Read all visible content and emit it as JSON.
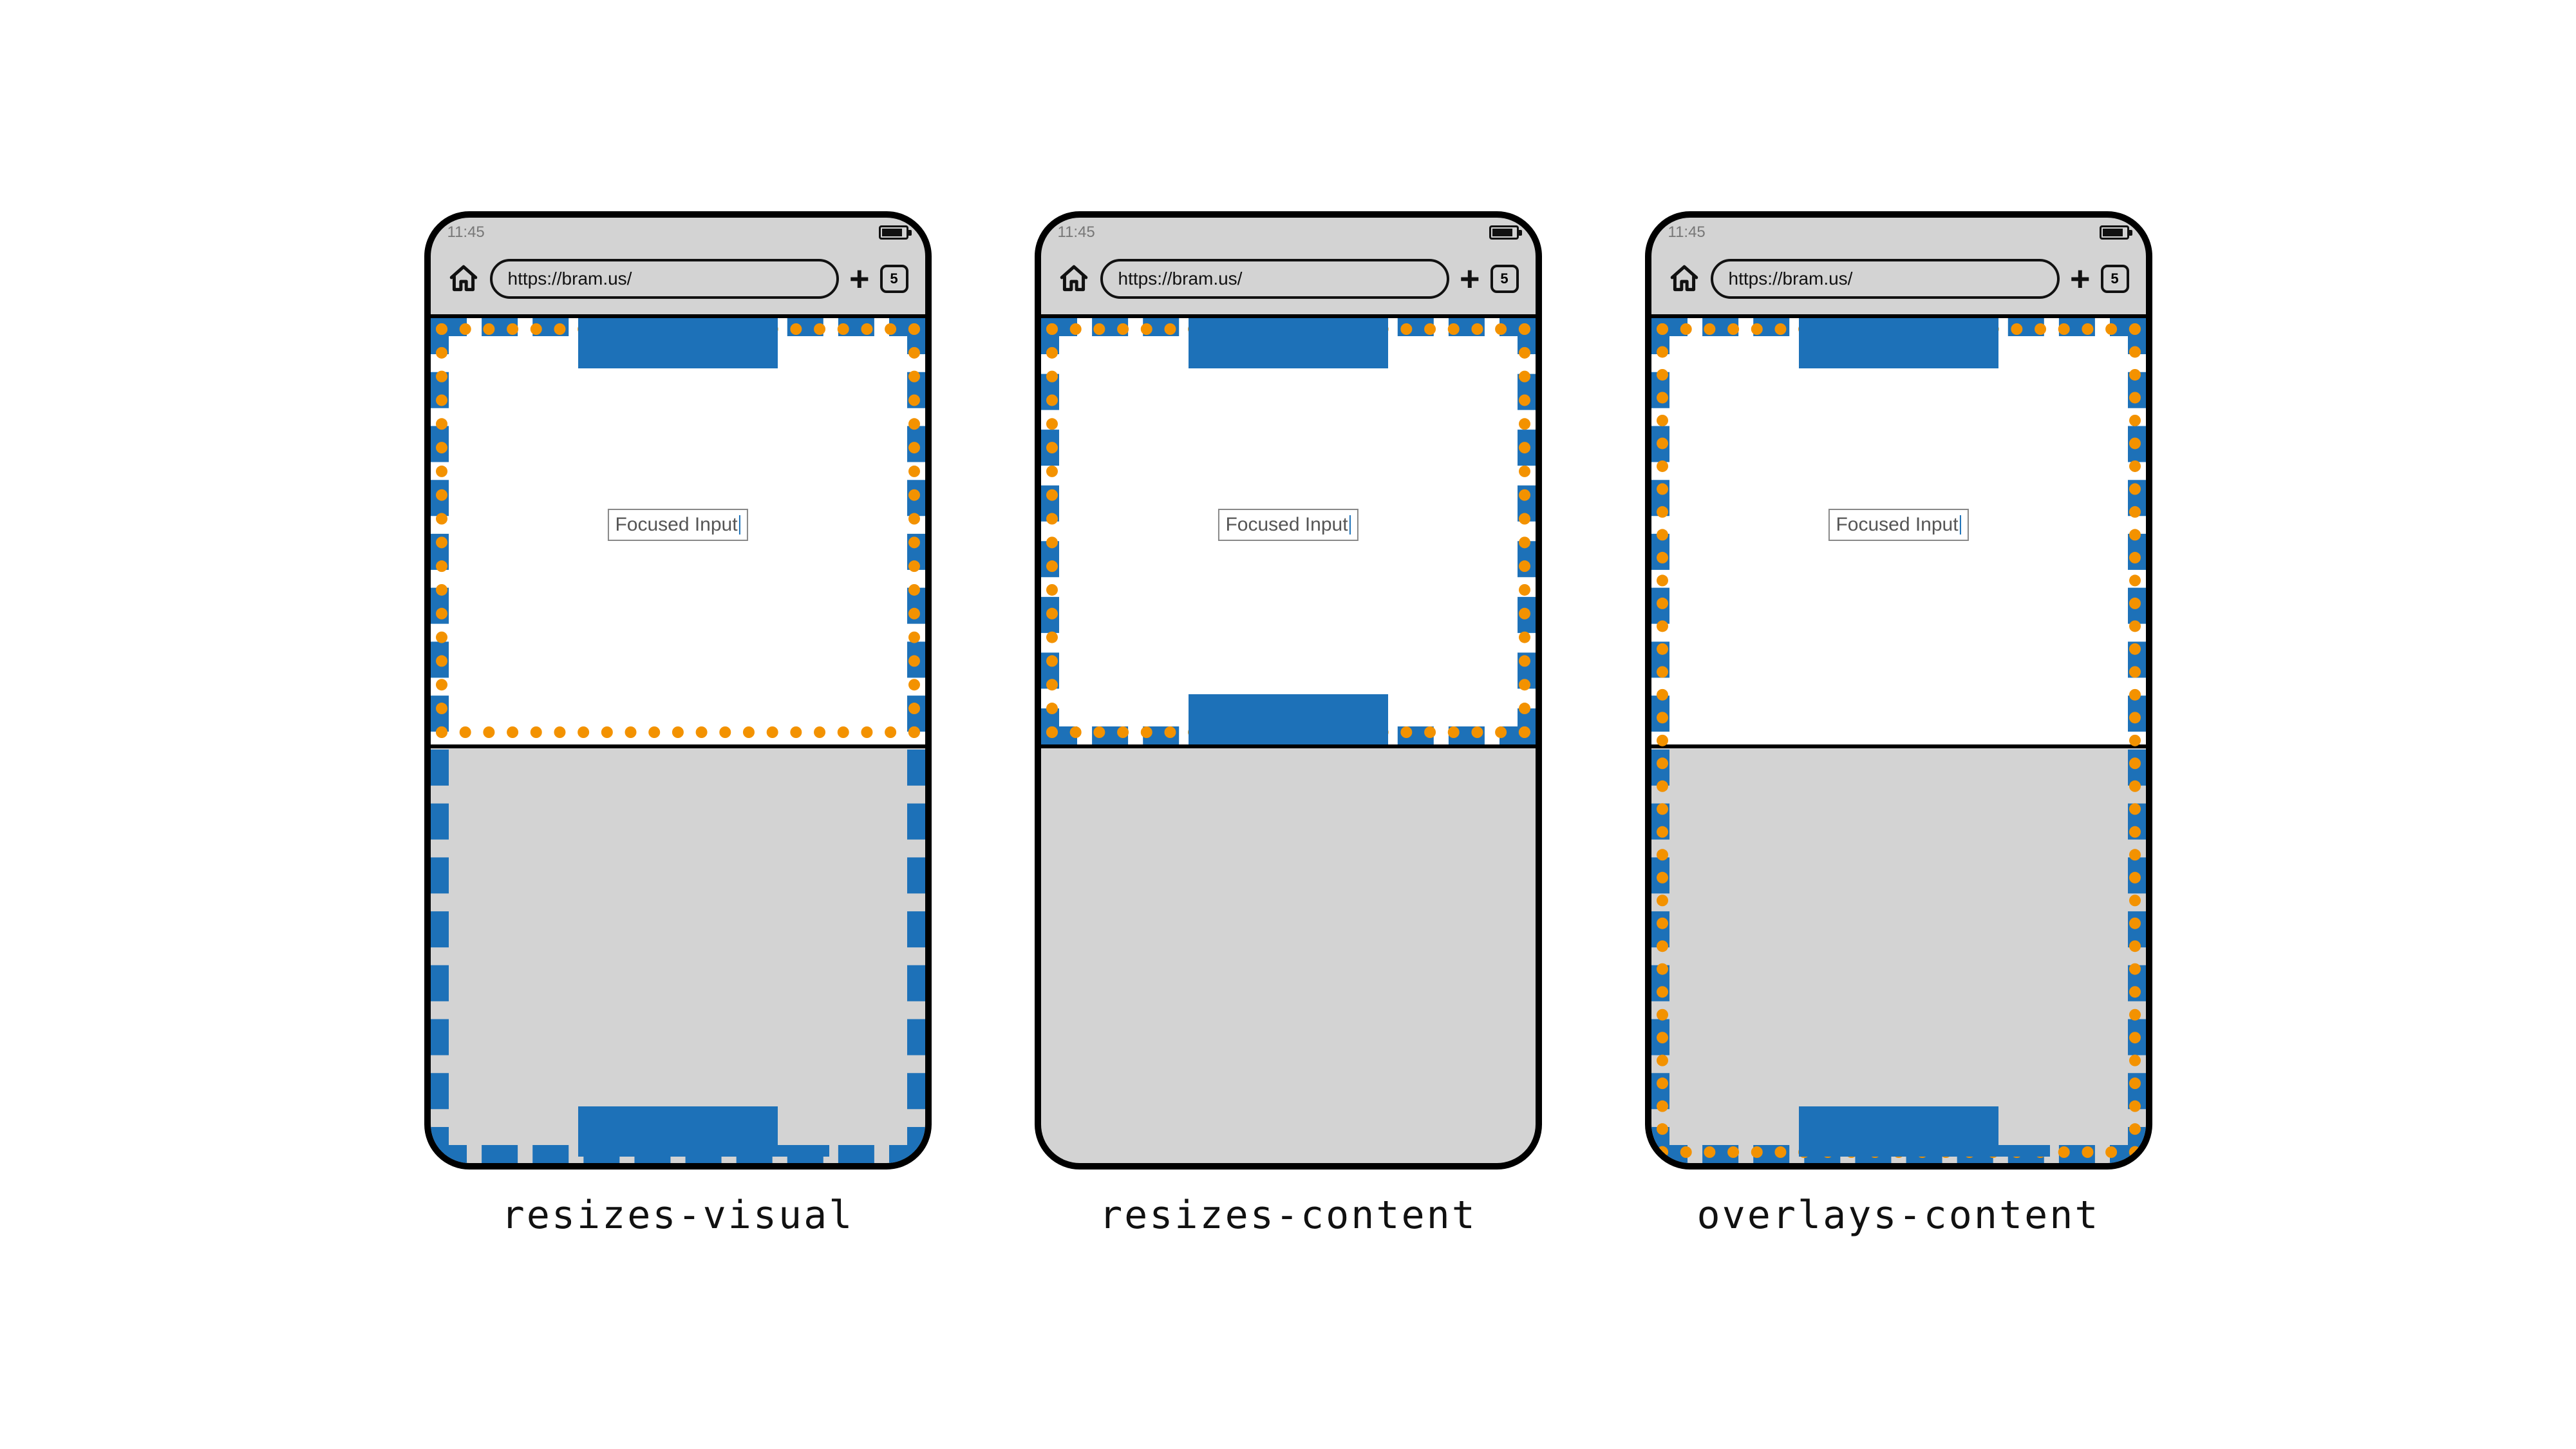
{
  "status_time": "11:45",
  "url": "https://bram.us/",
  "tab_count": "5",
  "input_label": "Focused Input",
  "labels": {
    "visual": "resizes-visual",
    "content": "resizes-content",
    "overlays": "overlays-content"
  },
  "colors": {
    "blue": "#1d71b8",
    "orange": "#f39200",
    "grey": "#d3d3d3"
  }
}
